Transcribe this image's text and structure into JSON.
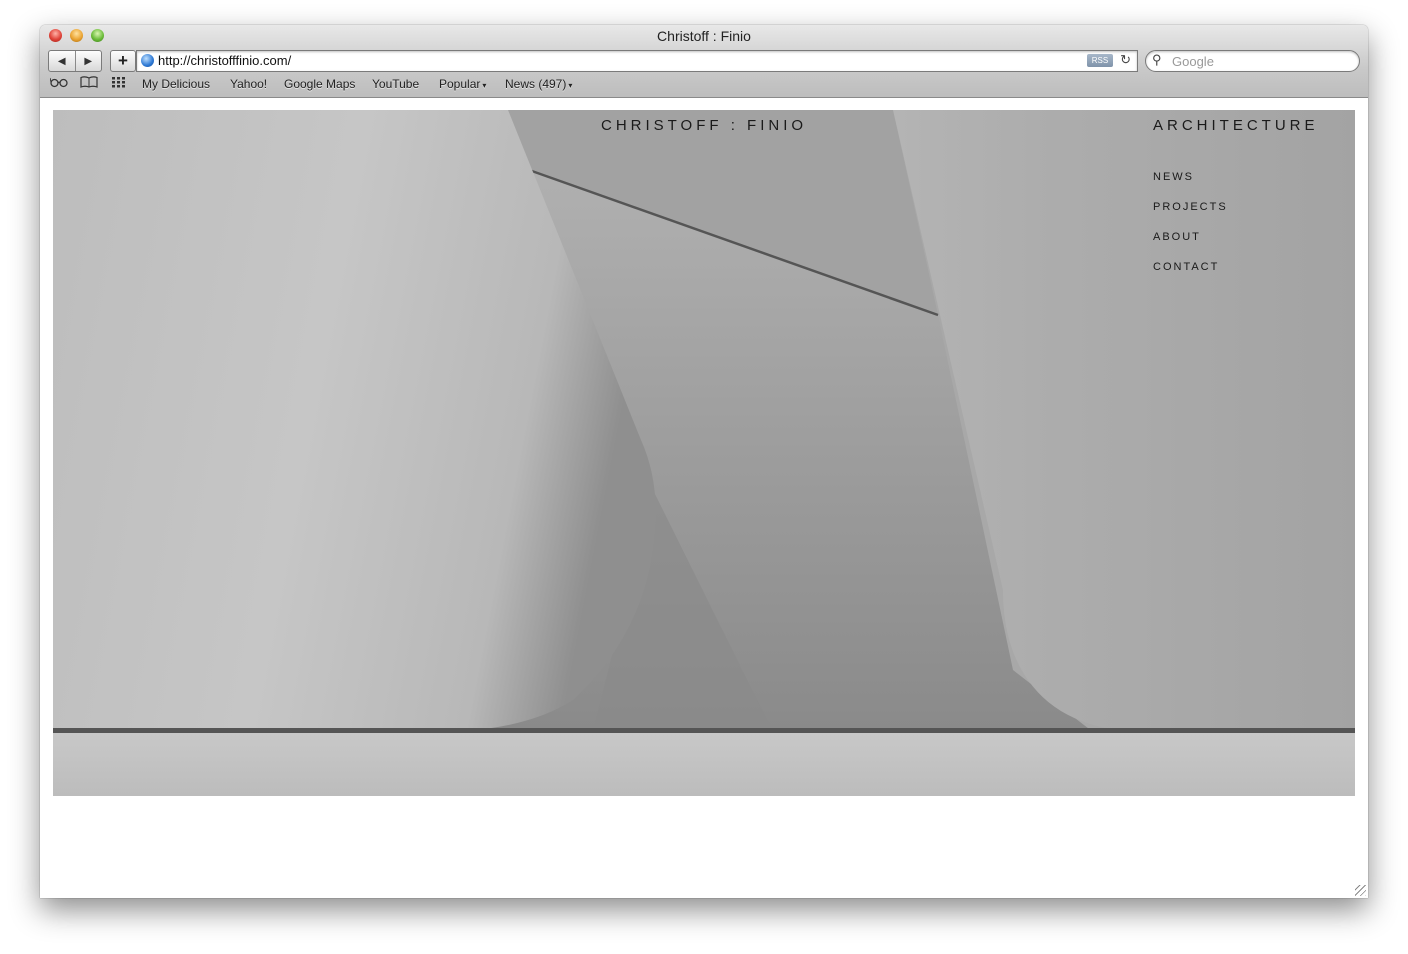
{
  "window": {
    "title": "Christoff : Finio"
  },
  "toolbar": {
    "back_icon": "◀",
    "forward_icon": "▶",
    "add_icon": "+",
    "url": "http://christofffinio.com/",
    "rss_label": "RSS",
    "reload_icon": "↻",
    "search_icon": "⚲",
    "search_placeholder": "Google"
  },
  "bookmarks": {
    "icons": [
      "reading-list-icon",
      "bookmarks-book-icon",
      "top-sites-grid-icon"
    ],
    "items": [
      {
        "label": "My Delicious"
      },
      {
        "label": "Yahoo!"
      },
      {
        "label": "Google Maps"
      },
      {
        "label": "YouTube"
      },
      {
        "label": "Popular",
        "dropdown": true
      },
      {
        "label": "News (497)",
        "dropdown": true
      }
    ],
    "dropdown_arrow": "▾"
  },
  "site": {
    "logo": "CHRISTOFF : FINIO",
    "tagline": "ARCHITECTURE",
    "nav": [
      {
        "label": "NEWS"
      },
      {
        "label": "PROJECTS"
      },
      {
        "label": "ABOUT"
      },
      {
        "label": "CONTACT"
      }
    ]
  },
  "colors": {
    "hero_background": "#a9a9a9",
    "text": "#1a1a1a"
  }
}
